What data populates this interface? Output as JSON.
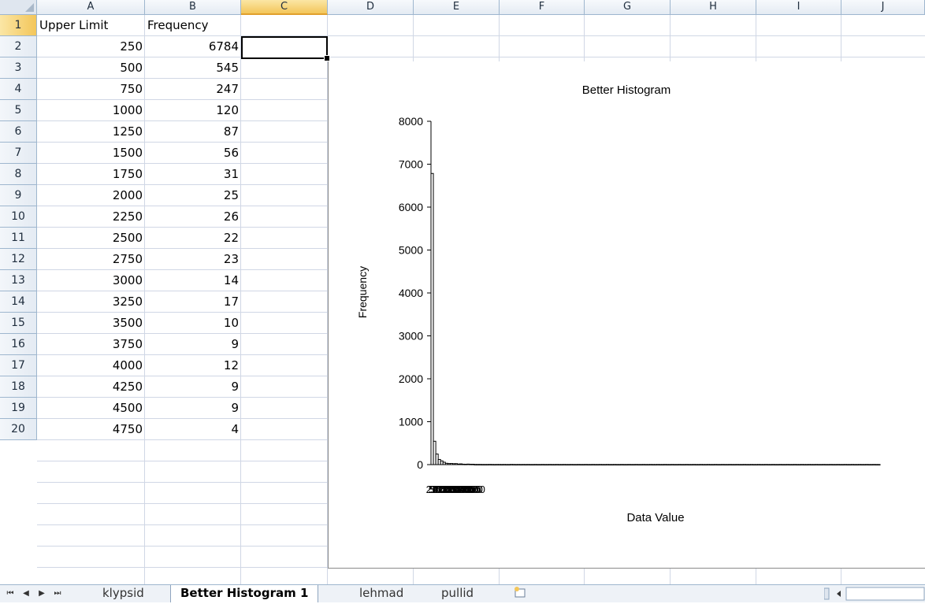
{
  "columns": [
    "A",
    "B",
    "C",
    "D",
    "E",
    "F",
    "G",
    "H",
    "I",
    "J"
  ],
  "rows": [
    "1",
    "2",
    "3",
    "4",
    "5",
    "6",
    "7",
    "8",
    "9",
    "10",
    "11",
    "12",
    "13",
    "14",
    "15",
    "16",
    "17",
    "18",
    "19",
    "20"
  ],
  "headers": {
    "a1": "Upper Limit",
    "b1": "Frequency"
  },
  "table": [
    [
      "250",
      "6784"
    ],
    [
      "500",
      "545"
    ],
    [
      "750",
      "247"
    ],
    [
      "1000",
      "120"
    ],
    [
      "1250",
      "87"
    ],
    [
      "1500",
      "56"
    ],
    [
      "1750",
      "31"
    ],
    [
      "2000",
      "25"
    ],
    [
      "2250",
      "26"
    ],
    [
      "2500",
      "22"
    ],
    [
      "2750",
      "23"
    ],
    [
      "3000",
      "14"
    ],
    [
      "3250",
      "17"
    ],
    [
      "3500",
      "10"
    ],
    [
      "3750",
      "9"
    ],
    [
      "4000",
      "12"
    ],
    [
      "4250",
      "9"
    ],
    [
      "4500",
      "9"
    ],
    [
      "4750",
      "4"
    ]
  ],
  "chart_data": {
    "type": "bar",
    "title": "Better Histogram",
    "xlabel": "Data Value",
    "ylabel": "Frequency",
    "ylim": [
      0,
      8000
    ],
    "yticks": [
      "0",
      "1000",
      "2000",
      "3000",
      "4000",
      "5000",
      "6000",
      "7000",
      "8000"
    ],
    "grid": false,
    "categories": [
      "250",
      "500",
      "750",
      "1000",
      "1250",
      "1500",
      "1750",
      "2000",
      "2250",
      "2500",
      "2750",
      "3000",
      "3250",
      "3500",
      "3750",
      "4000",
      "4250",
      "4500",
      "4750"
    ],
    "values": [
      6784,
      545,
      247,
      120,
      87,
      56,
      31,
      25,
      26,
      22,
      23,
      14,
      17,
      10,
      9,
      12,
      9,
      9,
      4
    ],
    "tail_values": [
      4,
      4,
      3,
      3,
      3,
      4,
      3,
      2,
      3,
      3,
      2,
      3,
      2,
      2,
      4,
      3,
      2,
      3,
      2,
      3,
      2,
      3,
      2,
      2,
      3,
      2,
      2,
      3,
      2,
      2,
      3,
      2,
      2,
      3,
      2,
      2,
      3,
      2,
      2,
      3,
      2,
      2,
      3,
      2,
      2,
      3,
      2,
      2,
      3,
      2,
      2,
      3,
      2,
      2,
      3,
      2,
      2,
      3,
      2,
      2,
      3,
      2,
      2,
      3,
      2,
      2,
      3,
      2,
      2,
      3,
      2,
      2,
      3,
      2,
      2,
      3,
      2,
      2,
      3,
      2,
      2,
      3,
      2,
      2,
      3,
      2,
      2,
      3,
      2,
      2,
      3,
      2,
      2,
      3,
      2,
      2,
      3,
      2,
      2,
      3,
      2,
      2,
      3,
      2,
      2,
      3,
      2,
      2,
      3,
      2,
      2,
      3,
      2,
      2,
      3,
      2,
      2,
      3,
      2,
      2,
      3,
      2,
      2,
      3,
      2,
      2,
      3,
      2,
      2,
      3,
      2,
      2,
      3,
      2,
      2,
      3,
      2,
      2,
      3,
      2,
      2,
      3,
      2,
      2,
      3,
      2,
      2,
      3,
      2,
      2,
      3,
      2,
      2,
      3,
      2,
      2,
      3,
      2,
      2,
      3,
      2,
      2,
      3,
      2,
      2,
      3,
      2,
      2
    ]
  },
  "tabs": {
    "items": [
      "klypsid",
      "Better Histogram 1",
      "lehmad",
      "pullid"
    ],
    "active": "Better Histogram 1",
    "nav": [
      "⏮",
      "◀",
      "▶",
      "⏭"
    ]
  },
  "colors": {
    "accent": "#f3c65a",
    "grid": "#d0d7e5",
    "header": "#e4ebf3"
  }
}
